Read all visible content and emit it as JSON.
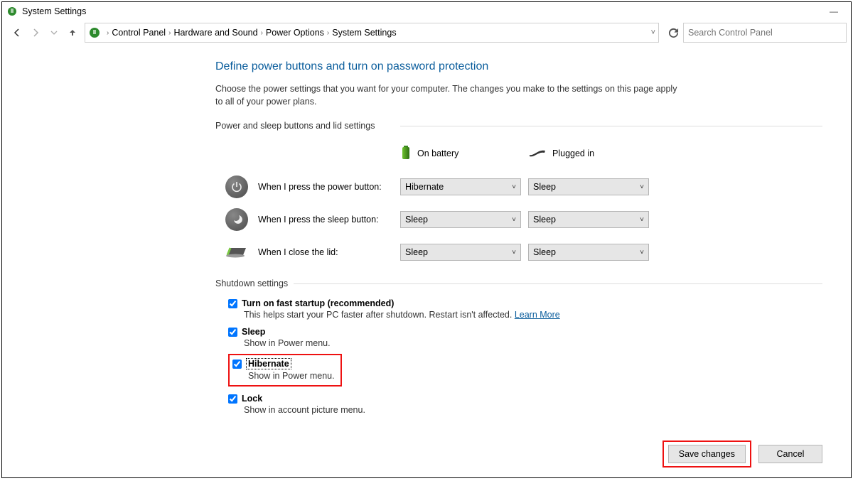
{
  "window": {
    "title": "System Settings"
  },
  "breadcrumb": {
    "items": [
      "Control Panel",
      "Hardware and Sound",
      "Power Options",
      "System Settings"
    ]
  },
  "search": {
    "placeholder": "Search Control Panel"
  },
  "heading": "Define power buttons and turn on password protection",
  "intro": "Choose the power settings that you want for your computer. The changes you make to the settings on this page apply to all of your power plans.",
  "section1_title": "Power and sleep buttons and lid settings",
  "columns": {
    "battery": "On battery",
    "plugged": "Plugged in"
  },
  "rows": {
    "power": {
      "label": "When I press the power button:",
      "battery": "Hibernate",
      "plugged": "Sleep"
    },
    "sleep": {
      "label": "When I press the sleep button:",
      "battery": "Sleep",
      "plugged": "Sleep"
    },
    "lid": {
      "label": "When I close the lid:",
      "battery": "Sleep",
      "plugged": "Sleep"
    }
  },
  "section2_title": "Shutdown settings",
  "shutdown": {
    "fast": {
      "label": "Turn on fast startup (recommended)",
      "desc_a": "This helps start your PC faster after shutdown. Restart isn't affected. ",
      "learn": "Learn More"
    },
    "sleep": {
      "label": "Sleep",
      "desc": "Show in Power menu."
    },
    "hib": {
      "label": "Hibernate",
      "desc": "Show in Power menu."
    },
    "lock": {
      "label": "Lock",
      "desc": "Show in account picture menu."
    }
  },
  "buttons": {
    "save": "Save changes",
    "cancel": "Cancel"
  }
}
